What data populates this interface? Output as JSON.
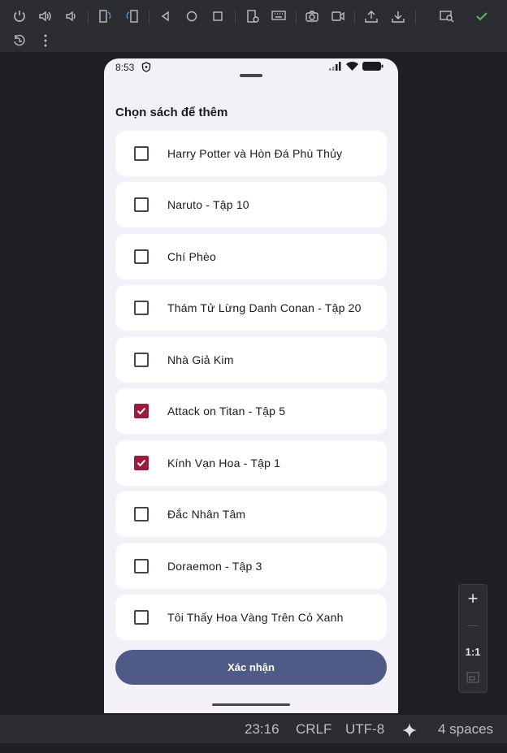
{
  "toolbar": {
    "icons": [
      "power-icon",
      "volume-up-icon",
      "volume-down-icon",
      "rotate-left-icon",
      "rotate-right-icon",
      "back-icon",
      "home-icon",
      "overview-icon",
      "settings-icon",
      "keyboard-icon",
      "camera-icon",
      "record-icon",
      "upload-icon",
      "download-icon",
      "inspect-icon",
      "check-icon",
      "reset-icon",
      "more-icon"
    ],
    "accent": "#5fb865"
  },
  "phone": {
    "status": {
      "time": "8:53"
    },
    "sheet": {
      "title": "Chọn sách để thêm",
      "books": [
        {
          "title": "Harry Potter và Hòn Đá Phù Thủy",
          "checked": false
        },
        {
          "title": "Naruto - Tập 10",
          "checked": false
        },
        {
          "title": "Chí Phèo",
          "checked": false
        },
        {
          "title": "Thám Tử Lừng Danh Conan - Tập 20",
          "checked": false
        },
        {
          "title": "Nhà Giả Kim",
          "checked": false
        },
        {
          "title": "Attack on Titan - Tập 5",
          "checked": true
        },
        {
          "title": "Kính Vạn Hoa - Tập 1",
          "checked": true
        },
        {
          "title": "Đắc Nhân Tâm",
          "checked": false
        },
        {
          "title": "Doraemon - Tập 3",
          "checked": false
        },
        {
          "title": "Tôi Thấy Hoa Vàng Trên Cỏ Xanh",
          "checked": false
        }
      ],
      "confirm_label": "Xác nhận"
    },
    "colors": {
      "checkbox_checked": "#9b1b3f",
      "button": "#4f5b86"
    }
  },
  "zoom": {
    "plus": "+",
    "minus": "—",
    "ratio": "1:1"
  },
  "status_bar": {
    "position": "23:16",
    "line_ending": "CRLF",
    "encoding": "UTF-8",
    "indent": "4 spaces"
  }
}
